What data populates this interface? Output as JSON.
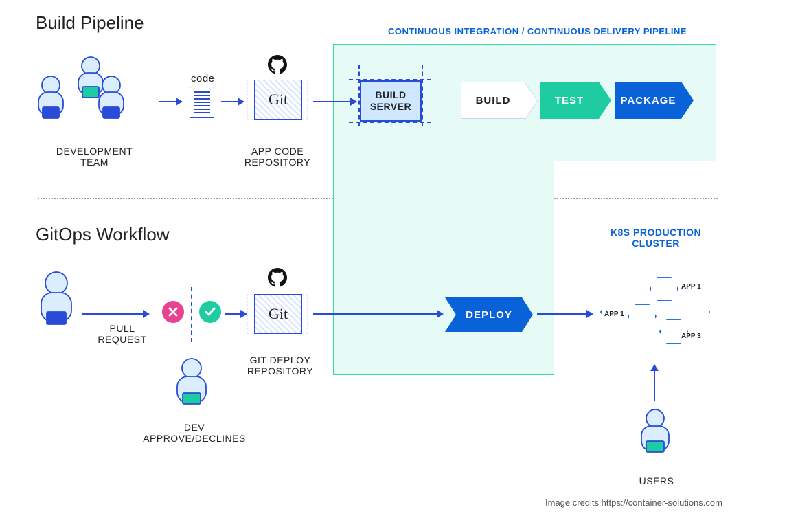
{
  "titles": {
    "build_pipeline": "Build Pipeline",
    "gitops_workflow": "GitOps Workflow"
  },
  "pipeline_banner": "CONTINUOUS INTEGRATION / CONTINUOUS DELIVERY PIPELINE",
  "build": {
    "dev_team_label": "DEVELOPMENT TEAM",
    "code_label": "code",
    "git_label": "Git",
    "app_repo_label": "APP  CODE\nREPOSITORY",
    "build_server": "BUILD\nSERVER",
    "stages": {
      "build": "BUILD",
      "test": "TEST",
      "package": "PACKAGE"
    }
  },
  "gitops": {
    "pull_request": "PULL\nREQUEST",
    "dev_approve": "DEV\nAPPROVE/DECLINES",
    "git_label": "Git",
    "deploy_repo_label": "GIT DEPLOY\nREPOSITORY",
    "deploy": "DEPLOY",
    "k8s_title": "K8S PRODUCTION\nCLUSTER",
    "apps": {
      "a1": "APP 1",
      "a2": "APP 1",
      "a3": "APP 3"
    },
    "users_label": "USERS"
  },
  "colors": {
    "blue": "#0a62d8",
    "teal": "#1fcba1",
    "mint_bg": "#e6fbf5",
    "pink": "#e84393"
  },
  "credits": "Image credits https://container-solutions.com"
}
